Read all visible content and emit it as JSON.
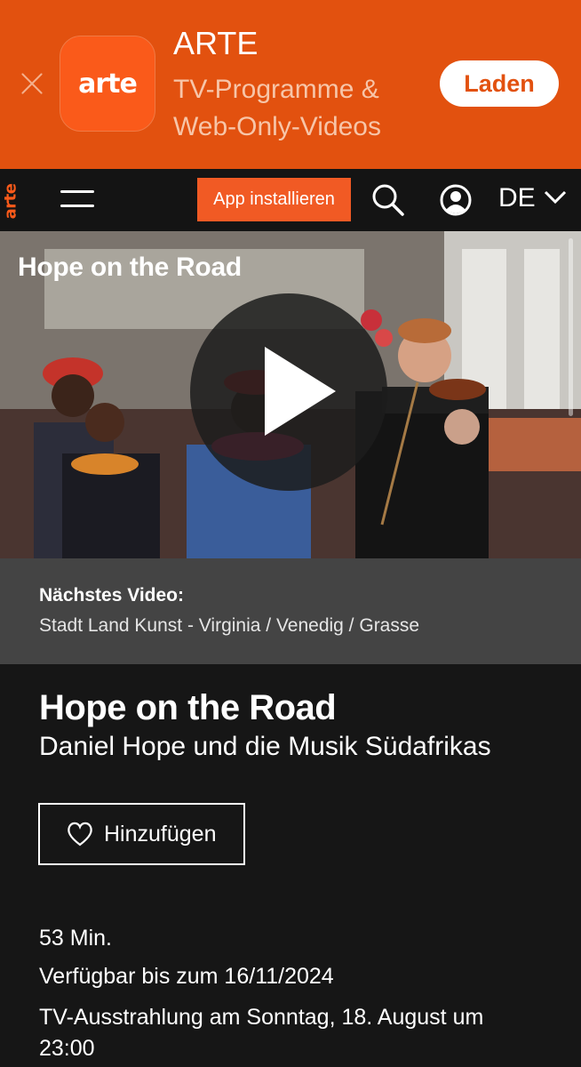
{
  "banner": {
    "app_name": "ARTE",
    "app_subtitle": "TV-Programme & Web-Only-Videos",
    "icon_text": "arte",
    "load_label": "Laden"
  },
  "header": {
    "logo": "arte",
    "install_label": "App installieren",
    "language": "DE"
  },
  "player": {
    "title": "Hope on the Road"
  },
  "next_video": {
    "label": "Nächstes Video:",
    "title": "Stadt Land Kunst - Virginia / Venedig / Grasse"
  },
  "program": {
    "title": "Hope on the Road",
    "subtitle": "Daniel Hope und die Musik Südafrikas",
    "add_label": "Hinzufügen",
    "duration": "53 Min.",
    "availability": "Verfügbar bis zum 16/11/2024",
    "broadcast": "TV-Ausstrahlung am Sonntag, 18. August um 23:00"
  },
  "colors": {
    "banner_bg": "#e2510f",
    "brand_orange": "#fa5a1a",
    "page_bg": "#161616",
    "next_bg": "#444444"
  },
  "icons": [
    "close-icon",
    "menu-icon",
    "search-icon",
    "user-icon",
    "chevron-down-icon",
    "play-icon",
    "heart-icon"
  ]
}
